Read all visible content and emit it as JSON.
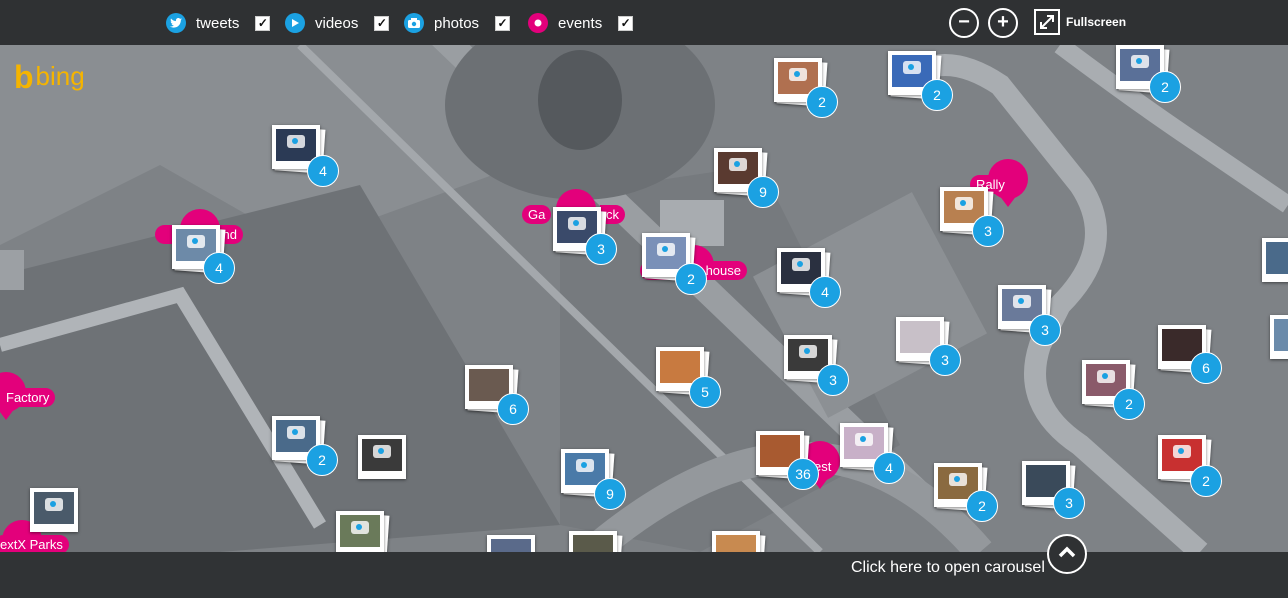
{
  "filters": [
    {
      "label": "tweets",
      "icon": "twitter-icon",
      "checked": true
    },
    {
      "label": "videos",
      "icon": "play-icon",
      "checked": true
    },
    {
      "label": "photos",
      "icon": "camera-icon",
      "checked": true
    },
    {
      "label": "events",
      "icon": "event-dot-icon",
      "checked": true
    }
  ],
  "toolbar": {
    "zoom_out": "−",
    "zoom_in": "+",
    "fullscreen_label": "Fullscreen"
  },
  "map": {
    "logo_text": "bing",
    "events": [
      "Rally",
      "Factory",
      "extX Parks",
      "Ga",
      "ck",
      "nd",
      "house",
      "est"
    ],
    "photo_counts": [
      "4",
      "4",
      "3",
      "2",
      "9",
      "2",
      "2",
      "3",
      "3",
      "2",
      "2",
      "4",
      "3",
      "3",
      "6",
      "6",
      "5",
      "9",
      "36",
      "4",
      "2",
      "3",
      "2",
      "2",
      "3"
    ]
  },
  "bottom": {
    "carousel_label": "Click here to open carousel"
  },
  "colors": {
    "accent_blue": "#1ba1e2",
    "event_pink": "#e3007b",
    "bar_bg": "#2f3133"
  }
}
